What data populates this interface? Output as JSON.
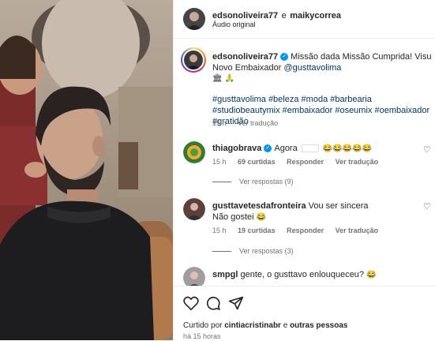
{
  "header": {
    "user1": "edsonoliveira77",
    "joiner": "e",
    "user2": "maikycorrea",
    "audio": "Áudio original",
    "more": "···"
  },
  "caption": {
    "username": "edsonoliveira77",
    "text": "Missão dada Missão Cumprida! Visu Novo Embaixador",
    "mention": "@gusttavolima",
    "emojis": "🏛 🙏",
    "hashtags": [
      "#gusttavolima",
      "#beleza",
      "#moda",
      "#barbearia",
      "#studiobeautymix",
      "#embaixador",
      "#oseumix",
      "#oembaixador",
      "#gratidão"
    ],
    "time": "15 h",
    "translate": "Ver tradução"
  },
  "comments": [
    {
      "username": "thiagobrava",
      "verified": true,
      "text": "Agora",
      "emojis": "😂😂😂😂😂",
      "time": "15 h",
      "likes": "69 curtidas",
      "reply": "Responder",
      "translate": "Ver tradução",
      "view_replies": "Ver respostas (9)"
    },
    {
      "username": "gusttavetesdafronteira",
      "verified": false,
      "text": "Vou ser sincera",
      "text2": "Não gostei",
      "emojis": "😂",
      "time": "15 h",
      "likes": "19 curtidas",
      "reply": "Responder",
      "translate": "Ver tradução",
      "view_replies": "Ver respostas (3)"
    },
    {
      "username": "smpgl",
      "verified": false,
      "text": "gente, o gusttavo enlouqueceu?",
      "emojis": "😂"
    }
  ],
  "actions": {
    "liked_by_prefix": "Curtido por",
    "liked_by_user": "cintiacristinabr",
    "liked_by_joiner": "e",
    "liked_by_others": "outras pessoas",
    "time_ago": "há 15 horas"
  },
  "colors": {
    "link": "#00376b",
    "verified": "#0095f6",
    "muted": "#737373"
  }
}
